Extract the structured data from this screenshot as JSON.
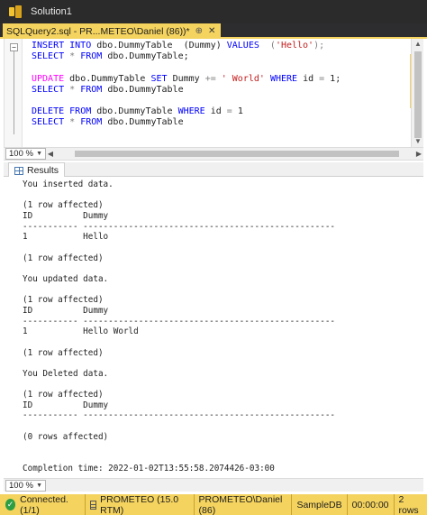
{
  "window": {
    "title": "Solution1"
  },
  "tab": {
    "label": "SQLQuery2.sql - PR...METEO\\Daniel (86))*",
    "pin": "⊕",
    "close": "✕"
  },
  "editor": {
    "collapse": "−",
    "lines": [
      [
        {
          "t": "INSERT INTO ",
          "c": "kw"
        },
        {
          "t": "dbo.DummyTable  (Dummy) ",
          "c": "tx"
        },
        {
          "t": "VALUES",
          "c": "kw"
        },
        {
          "t": "  (",
          "c": "gray"
        },
        {
          "t": "'Hello'",
          "c": "str"
        },
        {
          "t": ");",
          "c": "gray"
        }
      ],
      [
        {
          "t": "SELECT ",
          "c": "kw"
        },
        {
          "t": "* ",
          "c": "gray"
        },
        {
          "t": "FROM ",
          "c": "kw"
        },
        {
          "t": "dbo.DummyTable;",
          "c": "tx"
        }
      ],
      [
        {
          "t": "",
          "c": "tx"
        }
      ],
      [
        {
          "t": "UPDATE ",
          "c": "fn"
        },
        {
          "t": "dbo.DummyTable ",
          "c": "tx"
        },
        {
          "t": "SET ",
          "c": "kw"
        },
        {
          "t": "Dummy ",
          "c": "tx"
        },
        {
          "t": "+= ",
          "c": "gray"
        },
        {
          "t": "' World' ",
          "c": "str"
        },
        {
          "t": "WHERE ",
          "c": "kw"
        },
        {
          "t": "id ",
          "c": "tx"
        },
        {
          "t": "= ",
          "c": "gray"
        },
        {
          "t": "1;",
          "c": "tx"
        }
      ],
      [
        {
          "t": "SELECT ",
          "c": "kw"
        },
        {
          "t": "* ",
          "c": "gray"
        },
        {
          "t": "FROM ",
          "c": "kw"
        },
        {
          "t": "dbo.DummyTable",
          "c": "tx"
        }
      ],
      [
        {
          "t": "",
          "c": "tx"
        }
      ],
      [
        {
          "t": "DELETE ",
          "c": "kw"
        },
        {
          "t": "FROM ",
          "c": "kw"
        },
        {
          "t": "dbo.DummyTable ",
          "c": "tx"
        },
        {
          "t": "WHERE ",
          "c": "kw"
        },
        {
          "t": "id ",
          "c": "tx"
        },
        {
          "t": "= ",
          "c": "gray"
        },
        {
          "t": "1",
          "c": "tx"
        }
      ],
      [
        {
          "t": "SELECT ",
          "c": "kw"
        },
        {
          "t": "* ",
          "c": "gray"
        },
        {
          "t": "FROM ",
          "c": "kw"
        },
        {
          "t": "dbo.DummyTable",
          "c": "tx"
        }
      ]
    ]
  },
  "zoom": {
    "value": "100 %",
    "caret": "▼"
  },
  "results": {
    "tab_label": "Results",
    "lines": [
      "You inserted data.",
      "",
      "(1 row affected)",
      "ID          Dummy",
      "----------- --------------------------------------------------",
      "1           Hello",
      "",
      "(1 row affected)",
      "",
      "You updated data.",
      "",
      "(1 row affected)",
      "ID          Dummy",
      "----------- --------------------------------------------------",
      "1           Hello World",
      "",
      "(1 row affected)",
      "",
      "You Deleted data.",
      "",
      "(1 row affected)",
      "ID          Dummy",
      "----------- --------------------------------------------------",
      "",
      "(0 rows affected)",
      "",
      "",
      "Completion time: 2022-01-02T13:55:58.2074426-03:00"
    ]
  },
  "results_zoom": {
    "value": "100 %",
    "caret": "▼"
  },
  "status": {
    "check": "✓",
    "connected": "Connected. (1/1)",
    "server": "PROMETEO (15.0 RTM)",
    "user": "PROMETEO\\Daniel (86)",
    "database": "SampleDB",
    "elapsed": "00:00:00",
    "rows": "2 rows"
  },
  "colors": {
    "accent": "#f4d35e",
    "titlebar": "#2b2b2b",
    "keyword": "#0000ff",
    "string": "#c41e1e",
    "function": "#ff00ff"
  }
}
